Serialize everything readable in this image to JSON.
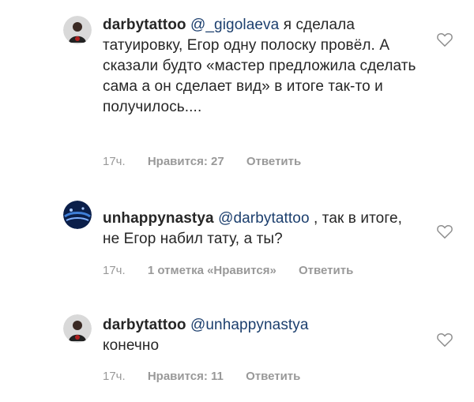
{
  "comments": [
    {
      "username": "darbytattoo",
      "mention": "@_gigolaeva",
      "text": " я сделала татуировку, Егор одну полоску провёл. А сказали будто «мастер предложила сделать сама а он сделает вид» в итоге так-то и получилось....",
      "time": "17ч.",
      "likes": "Нравится: 27",
      "reply": "Ответить",
      "avatar_icon": "tattoo-artist-avatar"
    },
    {
      "username": "unhappynastya",
      "mention": "@darbytattoo",
      "text": " , так в итоге, не Егор набил тату, а ты?",
      "time": "17ч.",
      "likes": "1 отметка «Нравится»",
      "reply": "Ответить",
      "avatar_icon": "blue-lights-avatar"
    },
    {
      "username": "darbytattoo",
      "mention": "@unhappynastya",
      "text": " конечно",
      "time": "17ч.",
      "likes": "Нравится: 11",
      "reply": "Ответить",
      "avatar_icon": "tattoo-artist-avatar"
    }
  ],
  "colors": {
    "text": "#262626",
    "mention": "#1c3f6e",
    "meta": "#999999"
  }
}
